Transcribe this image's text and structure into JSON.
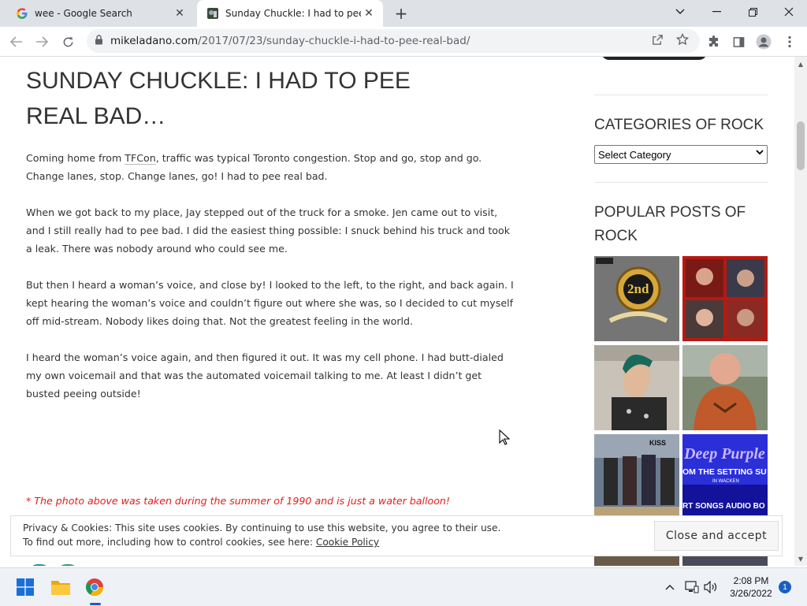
{
  "browser": {
    "tabs": [
      {
        "title": "wee - Google Search",
        "favicon": "google-g-icon",
        "active": false
      },
      {
        "title": "Sunday Chuckle: I had to pee rea",
        "favicon": "site-favicon",
        "active": true
      }
    ],
    "url_domain": "mikeladano.com",
    "url_path": "/2017/07/23/sunday-chuckle-i-had-to-pee-real-bad/"
  },
  "article": {
    "title": "SUNDAY CHUCKLE: I HAD TO PEE REAL BAD…",
    "p1_before_link": "Coming home from ",
    "p1_link": "TFCon",
    "p1_after_link": ", traffic was typical Toronto congestion.  Stop and go, stop and go.  Change lanes, stop.  Change lanes, go!  I had to pee real bad.",
    "p2": "When we got back to my place, Jay stepped out of the truck for a smoke.  Jen came out to visit, and I still really had to pee bad.  I did the easiest thing possible: I snuck behind his truck and took a leak.  There was nobody around who could see me.",
    "p3": "But then I heard a woman’s voice, and close by!  I looked to the left, to the right, and back again.  I kept hearing the woman’s voice and couldn’t figure out where she was, so I decided to cut myself off mid-stream.  Nobody likes doing that.  Not the greatest feeling in the world.",
    "p4": "I heard the woman’s voice again, and then figured it out.  It was my cell phone.  I had butt-dialed my own voicemail and that was the automated voicemail talking to me.  At least I didn’t get busted peeing outside!",
    "caption": "* The photo above was taken during the summer of 1990 and is just a water balloon!"
  },
  "sidebar": {
    "categories_title": "CATEGORIES OF ROCK",
    "category_select_value": "Select Category",
    "popular_title": "POPULAR POSTS OF ROCK",
    "thumb1_text": "2nd",
    "thumb5_text": "KISS",
    "thumb6_line1": "Deep Purple",
    "thumb6_line2": "OM THE SETTING SU",
    "thumb6_line3": "IN WACKEN",
    "thumb6_line4": "RT  SONGS  AUDIO  BO"
  },
  "cookie_banner": {
    "line1": "Privacy & Cookies: This site uses cookies. By continuing to use this website, you agree to their use.",
    "line2_prefix": "To find out more, including how to control cookies, see here: ",
    "link": "Cookie Policy",
    "button": "Close and accept"
  },
  "taskbar": {
    "time": "2:08 PM",
    "date": "3/26/2022",
    "notification_count": "1"
  },
  "colors": {
    "caption_red": "#e0201a",
    "tab_strip": "#dee1e6",
    "accent_blue": "#1a5fc0"
  }
}
